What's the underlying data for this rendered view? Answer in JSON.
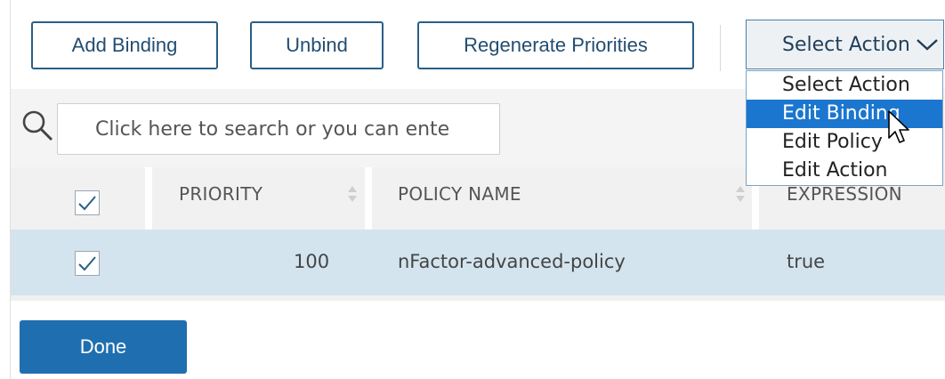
{
  "toolbar": {
    "add_binding_label": "Add Binding",
    "unbind_label": "Unbind",
    "regenerate_label": "Regenerate Priorities",
    "select_action": {
      "value": "Select Action",
      "options": [
        "Select Action",
        "Edit Binding",
        "Edit Policy",
        "Edit Action"
      ],
      "highlighted": "Edit Binding"
    }
  },
  "search": {
    "placeholder": "Click here to search or you can ente",
    "icon": "search-icon"
  },
  "table": {
    "columns": [
      "PRIORITY",
      "POLICY NAME",
      "EXPRESSION"
    ],
    "rows": [
      {
        "checked": true,
        "priority": "100",
        "policy_name": "nFactor-advanced-policy",
        "expression": "true"
      }
    ],
    "select_all_checked": true
  },
  "footer": {
    "done_label": "Done"
  },
  "colors": {
    "accent": "#1f6fb0",
    "outline": "#2a5f86",
    "selected_row": "#d3e4ee",
    "highlight": "#1b76cf"
  }
}
